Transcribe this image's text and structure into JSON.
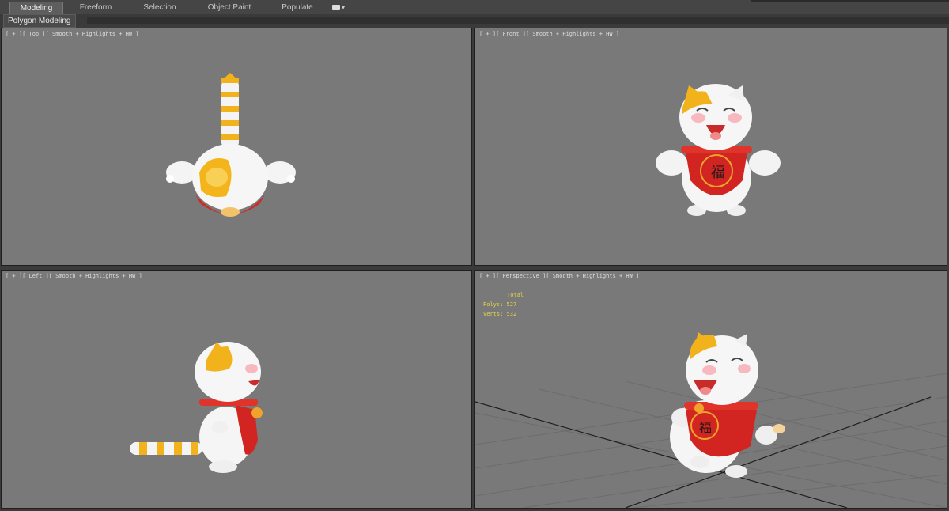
{
  "tabs": [
    {
      "label": "Modeling",
      "active": true
    },
    {
      "label": "Freeform",
      "active": false
    },
    {
      "label": "Selection",
      "active": false
    },
    {
      "label": "Object Paint",
      "active": false
    },
    {
      "label": "Populate",
      "active": false
    }
  ],
  "ribbon": {
    "label": "Polygon Modeling"
  },
  "viewports": {
    "top": {
      "label": "[ + ][ Top ][ Smooth + Highlights + HW ]"
    },
    "front": {
      "label": "[ + ][ Front ][ Smooth + Highlights + HW ]"
    },
    "left": {
      "label": "[ + ][ Left ][ Smooth + Highlights + HW ]"
    },
    "perspective": {
      "label": "[ + ][ Perspective ][ Smooth + Highlights + HW ]"
    }
  },
  "stats": {
    "header": "Total",
    "polys_label": "Polys:",
    "polys_value": "527",
    "verts_label": "Verts:",
    "verts_value": "532"
  },
  "colors": {
    "viewport_bg": "#797979",
    "stats_text": "#e8d34a",
    "cat_white": "#f4f4f4",
    "cat_orange": "#f2b21b",
    "bib_red": "#d0211c"
  }
}
